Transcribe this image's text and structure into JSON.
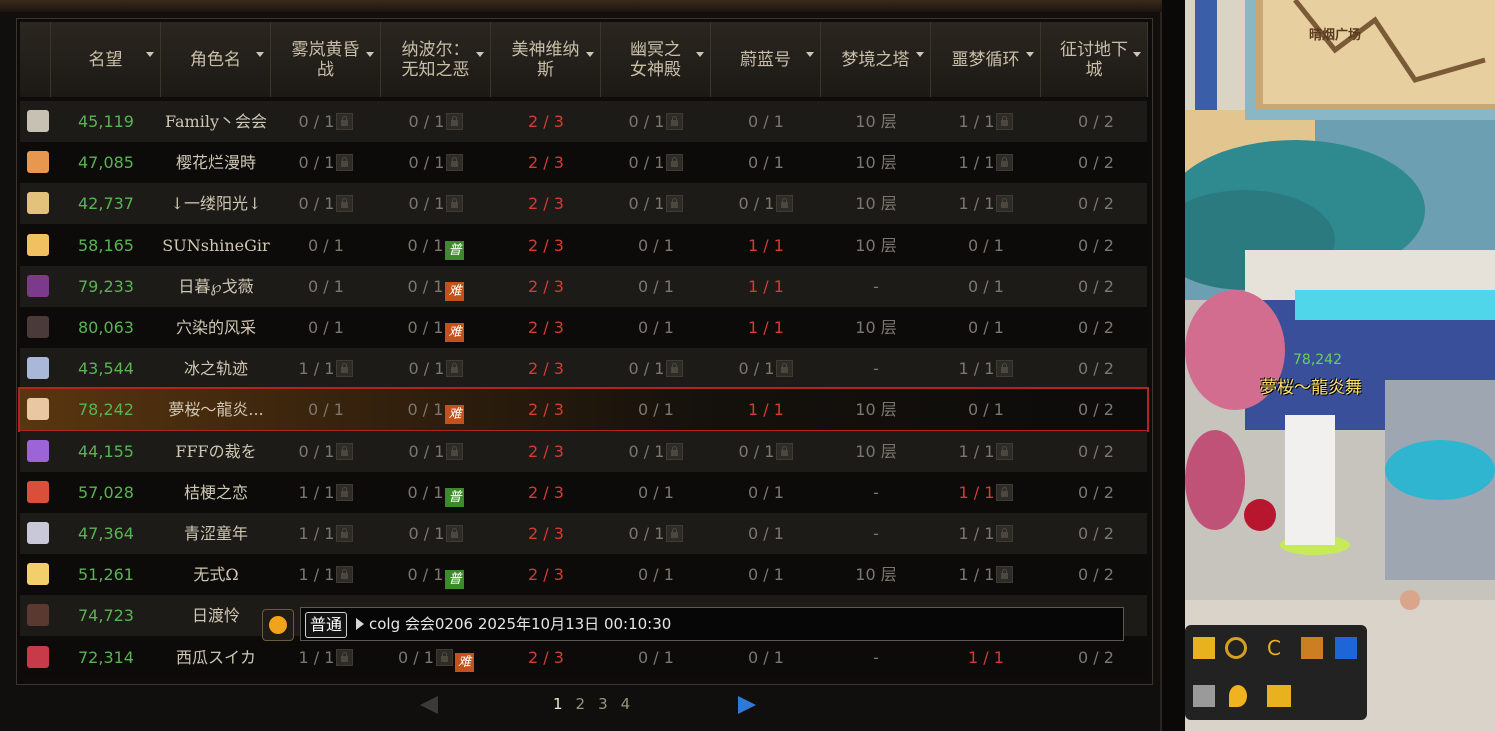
{
  "table": {
    "headers": [
      {
        "label": "名望"
      },
      {
        "label": "角色名"
      },
      {
        "label": "雾岚黄昏战"
      },
      {
        "label": "纳波尔：无知之恶"
      },
      {
        "label": "美神维纳斯"
      },
      {
        "label": "幽冥之女神殿"
      },
      {
        "label": "蔚蓝号"
      },
      {
        "label": "梦境之塔"
      },
      {
        "label": "噩梦循环"
      },
      {
        "label": "征讨地下城"
      }
    ],
    "rows": [
      {
        "fame": "45,119",
        "name": "Family丶会会",
        "c": [
          "0 / 1",
          "0 / 1",
          "2 / 3",
          "0 / 1",
          "0 / 1",
          "10 层",
          "1 / 1",
          "0 / 2"
        ]
      },
      {
        "fame": "47,085",
        "name": "樱花烂漫時",
        "c": [
          "0 / 1",
          "0 / 1",
          "2 / 3",
          "0 / 1",
          "0 / 1",
          "10 层",
          "1 / 1",
          "0 / 2"
        ]
      },
      {
        "fame": "42,737",
        "name": "↓一缕阳光↓",
        "c": [
          "0 / 1",
          "0 / 1",
          "2 / 3",
          "0 / 1",
          "0 / 1",
          "10 层",
          "1 / 1",
          "0 / 2"
        ]
      },
      {
        "fame": "58,165",
        "name": "SUNshineGir",
        "c": [
          "0 / 1",
          "0 / 1",
          "2 / 3",
          "0 / 1",
          "1 / 1",
          "10 层",
          "0 / 1",
          "0 / 2"
        ]
      },
      {
        "fame": "79,233",
        "name": "日暮℘戈薇",
        "c": [
          "0 / 1",
          "0 / 1",
          "2 / 3",
          "0 / 1",
          "1 / 1",
          "-",
          "0 / 1",
          "0 / 2"
        ]
      },
      {
        "fame": "80,063",
        "name": "穴染的风采",
        "c": [
          "0 / 1",
          "0 / 1",
          "2 / 3",
          "0 / 1",
          "1 / 1",
          "10 层",
          "0 / 1",
          "0 / 2"
        ]
      },
      {
        "fame": "43,544",
        "name": "冰之轨迹",
        "c": [
          "1 / 1",
          "0 / 1",
          "2 / 3",
          "0 / 1",
          "0 / 1",
          "-",
          "1 / 1",
          "0 / 2"
        ]
      },
      {
        "fame": "78,242",
        "name": "夢桜～龍炎...",
        "c": [
          "0 / 1",
          "0 / 1",
          "2 / 3",
          "0 / 1",
          "1 / 1",
          "10 层",
          "0 / 1",
          "0 / 2"
        ]
      },
      {
        "fame": "44,155",
        "name": "FFFの裁を",
        "c": [
          "0 / 1",
          "0 / 1",
          "2 / 3",
          "0 / 1",
          "0 / 1",
          "10 层",
          "1 / 1",
          "0 / 2"
        ]
      },
      {
        "fame": "57,028",
        "name": "桔梗之恋",
        "c": [
          "1 / 1",
          "0 / 1",
          "2 / 3",
          "0 / 1",
          "0 / 1",
          "-",
          "1 / 1",
          "0 / 2"
        ]
      },
      {
        "fame": "47,364",
        "name": "青涩童年",
        "c": [
          "1 / 1",
          "0 / 1",
          "2 / 3",
          "0 / 1",
          "0 / 1",
          "-",
          "1 / 1",
          "0 / 2"
        ]
      },
      {
        "fame": "51,261",
        "name": "无式Ω",
        "c": [
          "1 / 1",
          "0 / 1",
          "2 / 3",
          "0 / 1",
          "0 / 1",
          "10 层",
          "1 / 1",
          "0 / 2"
        ]
      },
      {
        "fame": "74,723",
        "name": "日渡怜",
        "c": [
          "",
          "",
          "",
          "",
          "",
          "",
          "",
          ""
        ]
      },
      {
        "fame": "72,314",
        "name": "西瓜スイカ",
        "c": [
          "1 / 1",
          "0 / 1",
          "2 / 3",
          "0 / 1",
          "0 / 1",
          "-",
          "1 / 1",
          "0 / 2"
        ]
      }
    ]
  },
  "badges": {
    "easy": "普",
    "hard": "难"
  },
  "pagination": {
    "pages": [
      "1",
      "2",
      "3",
      "4"
    ],
    "current": "1"
  },
  "chat": {
    "channel": "普通",
    "text": "colg 会会0206 2025年10月13日 00:10:30"
  },
  "scene": {
    "location_label": "晴烟广场",
    "player_fame": "78,242",
    "player_name": "夢桜～龍炎舞"
  },
  "colors": {
    "accent_red": "#d63a35",
    "fame_green": "#58b450",
    "selection_border": "#b3231f"
  }
}
